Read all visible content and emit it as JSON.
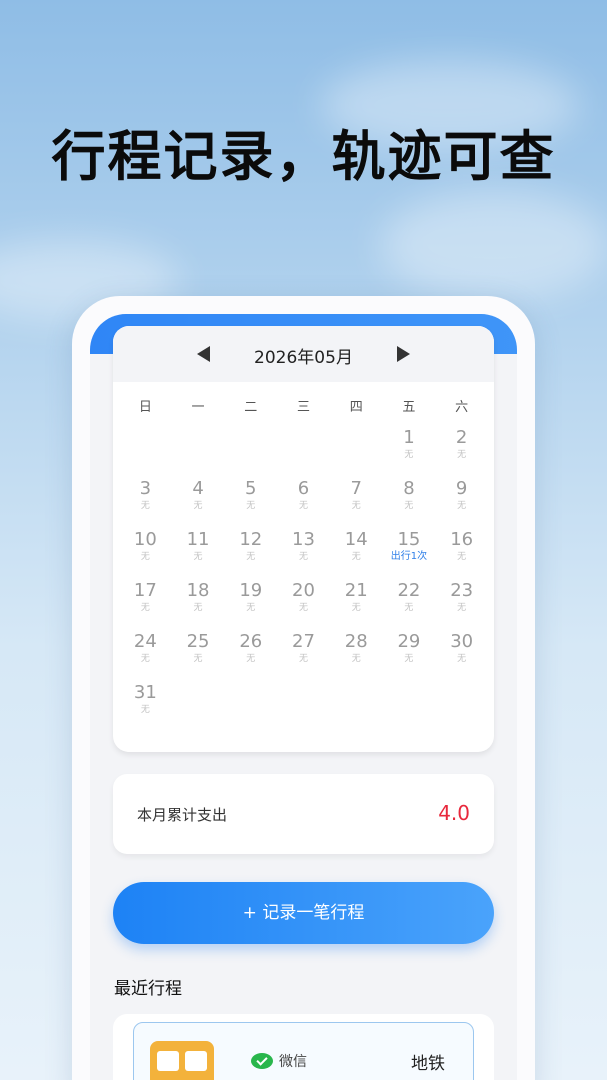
{
  "headline": "行程记录，轨迹可查",
  "calendar": {
    "title": "2026年05月",
    "weekdays": [
      "日",
      "一",
      "二",
      "三",
      "四",
      "五",
      "六"
    ],
    "days": [
      {
        "n": "",
        "s": ""
      },
      {
        "n": "",
        "s": ""
      },
      {
        "n": "",
        "s": ""
      },
      {
        "n": "",
        "s": ""
      },
      {
        "n": "",
        "s": ""
      },
      {
        "n": "1",
        "s": "无"
      },
      {
        "n": "2",
        "s": "无"
      },
      {
        "n": "3",
        "s": "无"
      },
      {
        "n": "4",
        "s": "无"
      },
      {
        "n": "5",
        "s": "无"
      },
      {
        "n": "6",
        "s": "无"
      },
      {
        "n": "7",
        "s": "无"
      },
      {
        "n": "8",
        "s": "无"
      },
      {
        "n": "9",
        "s": "无"
      },
      {
        "n": "10",
        "s": "无"
      },
      {
        "n": "11",
        "s": "无"
      },
      {
        "n": "12",
        "s": "无"
      },
      {
        "n": "13",
        "s": "无"
      },
      {
        "n": "14",
        "s": "无"
      },
      {
        "n": "15",
        "s": "出行1次",
        "active": true
      },
      {
        "n": "16",
        "s": "无"
      },
      {
        "n": "17",
        "s": "无"
      },
      {
        "n": "18",
        "s": "无"
      },
      {
        "n": "19",
        "s": "无"
      },
      {
        "n": "20",
        "s": "无"
      },
      {
        "n": "21",
        "s": "无"
      },
      {
        "n": "22",
        "s": "无"
      },
      {
        "n": "23",
        "s": "无"
      },
      {
        "n": "24",
        "s": "无"
      },
      {
        "n": "25",
        "s": "无"
      },
      {
        "n": "26",
        "s": "无"
      },
      {
        "n": "27",
        "s": "无"
      },
      {
        "n": "28",
        "s": "无"
      },
      {
        "n": "29",
        "s": "无"
      },
      {
        "n": "30",
        "s": "无"
      },
      {
        "n": "31",
        "s": "无"
      }
    ]
  },
  "stats": {
    "label": "本月累计支出",
    "value": "4.0"
  },
  "record_button": "+ 记录一笔行程",
  "recent": {
    "title": "最近行程",
    "trip": {
      "pay_method": "微信",
      "mode": "地铁"
    }
  },
  "colors": {
    "accent": "#2f86f6",
    "expense": "#e8283c",
    "active_day": "#2f7fe8"
  },
  "icons": {
    "prev": "chevron-left-icon",
    "next": "chevron-right-icon",
    "wechat": "wechat-icon",
    "subway": "subway-icon"
  }
}
